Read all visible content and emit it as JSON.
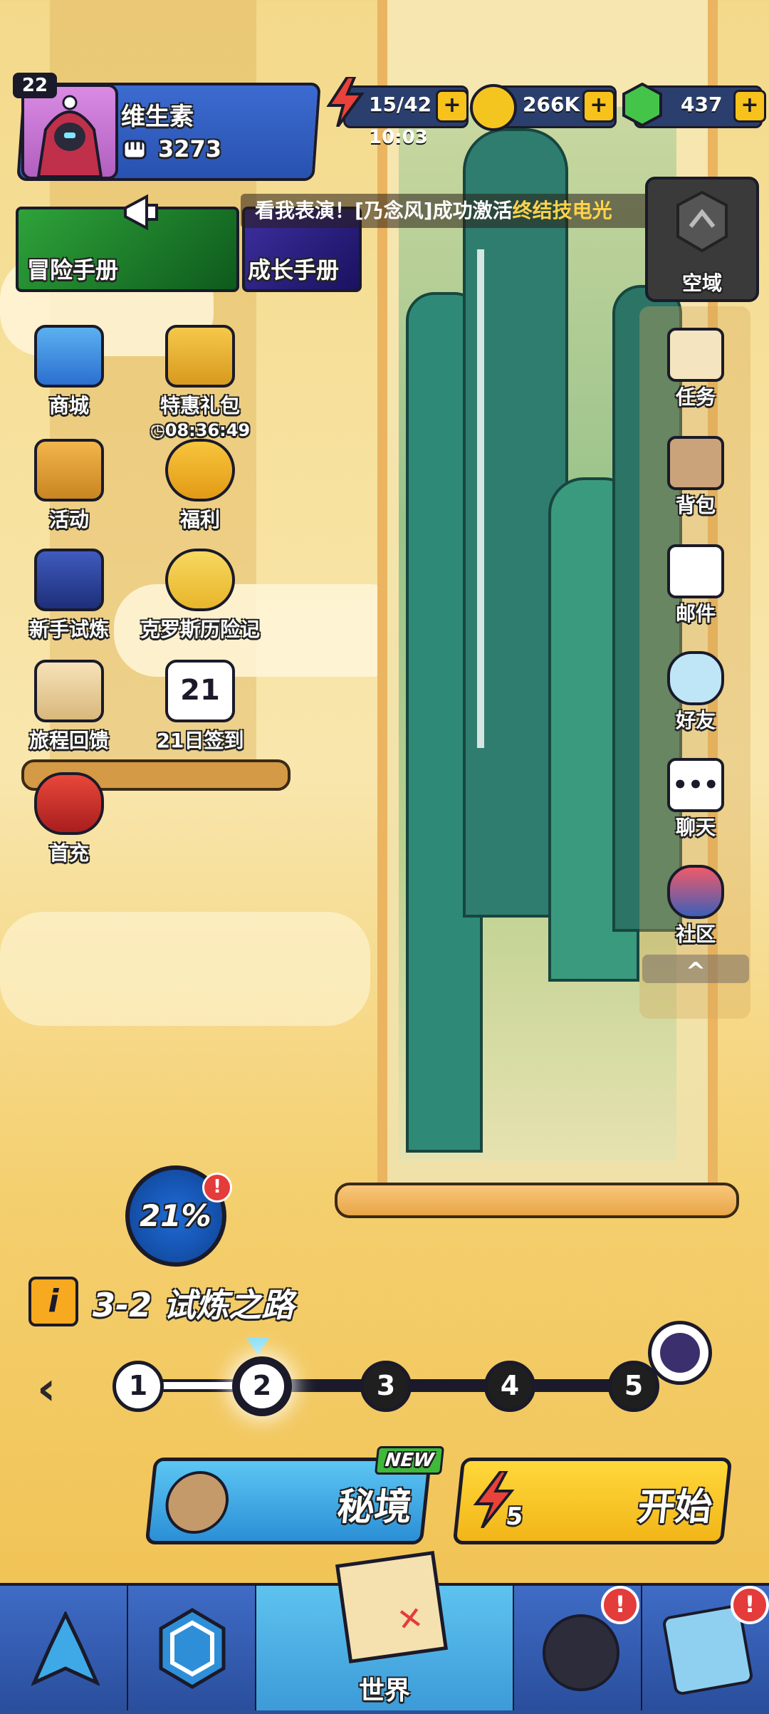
{
  "player": {
    "level": "22",
    "name": "维生素",
    "power": "3273"
  },
  "resources": {
    "energy": "15/42",
    "energy_timer": "10:03",
    "gold": "266K",
    "gems": "437",
    "plus": "+"
  },
  "handbooks": {
    "adventure": "冒险手册",
    "growth": "成长手册"
  },
  "ticker": {
    "prefix": "看我表演！[乃念风]成功激活",
    "highlight": "终结技电光"
  },
  "void": {
    "label": "空域"
  },
  "left_menu": {
    "shop": "商城",
    "special_pack": "特惠礼包",
    "special_pack_timer": "08:36:49",
    "events": "活动",
    "welfare": "福利",
    "novice_trial": "新手试炼",
    "cross_adventure": "克罗斯历险记",
    "journey_feedback": "旅程回馈",
    "signin": "21日签到",
    "signin_day": "21",
    "first_recharge": "首充"
  },
  "right_menu": {
    "tasks": "任务",
    "bag": "背包",
    "mail": "邮件",
    "friends": "好友",
    "chat": "聊天",
    "community": "社区",
    "collapse": "^"
  },
  "stage": {
    "progress": "21%",
    "info_icon": "i",
    "title": "3-2 试炼之路",
    "nodes": [
      "1",
      "2",
      "3",
      "4",
      "5"
    ],
    "current_node": 2
  },
  "actions": {
    "secret_realm": "秘境",
    "new_badge": "NEW",
    "start": "开始",
    "energy_cost": "5"
  },
  "nav": {
    "world": "世界",
    "alert": "!"
  },
  "colors": {
    "accent_blue": "#3c9bd8",
    "start_yellow": "#f7c21b",
    "gem_green": "#45c44a",
    "alert_red": "#e43b3b"
  }
}
